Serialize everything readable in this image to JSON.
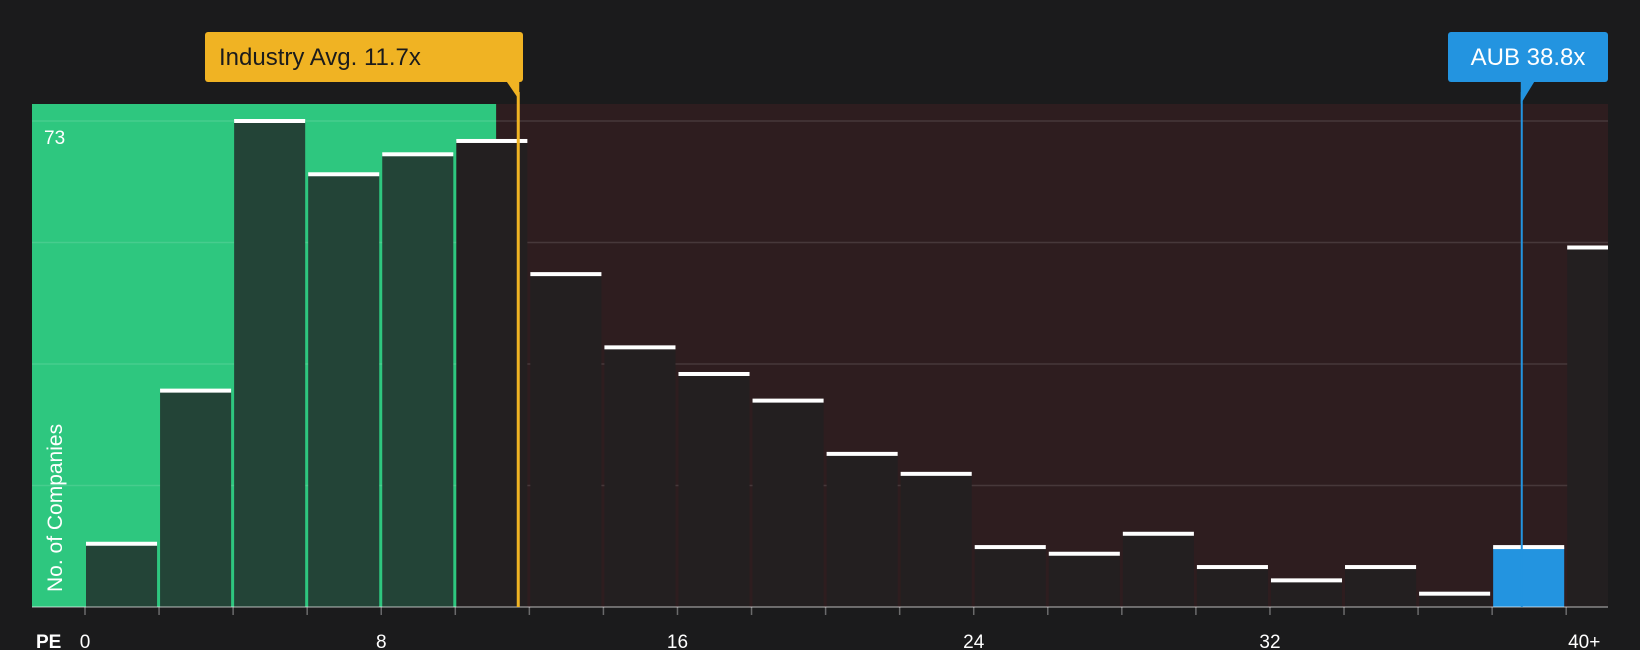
{
  "chart_data": {
    "type": "bar",
    "xlabel": "PE",
    "ylabel": "No. of Companies",
    "y_max_label": "73",
    "ylim": [
      0,
      73
    ],
    "x_ticks": [
      {
        "value": 0,
        "label": "0"
      },
      {
        "value": 8,
        "label": "8"
      },
      {
        "value": 16,
        "label": "16"
      },
      {
        "value": 24,
        "label": "24"
      },
      {
        "value": 32,
        "label": "32"
      },
      {
        "value": 40,
        "label": "40+"
      }
    ],
    "bin_width": 2,
    "bins": [
      {
        "start": 0,
        "value": 9.5
      },
      {
        "start": 2,
        "value": 32.5
      },
      {
        "start": 4,
        "value": 73
      },
      {
        "start": 6,
        "value": 65
      },
      {
        "start": 8,
        "value": 68
      },
      {
        "start": 10,
        "value": 70
      },
      {
        "start": 12,
        "value": 50
      },
      {
        "start": 14,
        "value": 39
      },
      {
        "start": 16,
        "value": 35
      },
      {
        "start": 18,
        "value": 31
      },
      {
        "start": 20,
        "value": 23
      },
      {
        "start": 22,
        "value": 20
      },
      {
        "start": 24,
        "value": 9
      },
      {
        "start": 26,
        "value": 8
      },
      {
        "start": 28,
        "value": 11
      },
      {
        "start": 30,
        "value": 6
      },
      {
        "start": 32,
        "value": 4
      },
      {
        "start": 34,
        "value": 6
      },
      {
        "start": 36,
        "value": 2
      },
      {
        "start": 38,
        "value": 9,
        "highlight": true
      },
      {
        "start": 40,
        "value": 54
      }
    ],
    "industry_avg": {
      "label": "Industry Avg. 11.7x",
      "value": 11.7
    },
    "company": {
      "label": "AUB 38.8x",
      "value": 38.8
    },
    "colors": {
      "background": "#1b1b1c",
      "below_zone": "#2ec77f",
      "above_zone": "#2e1d1f",
      "bar_in_zone": "#234437",
      "bar_out_zone": "#231f20",
      "highlight": "#2394e0",
      "avg_marker": "#f0b323",
      "bar_top": "#ffffff"
    }
  }
}
